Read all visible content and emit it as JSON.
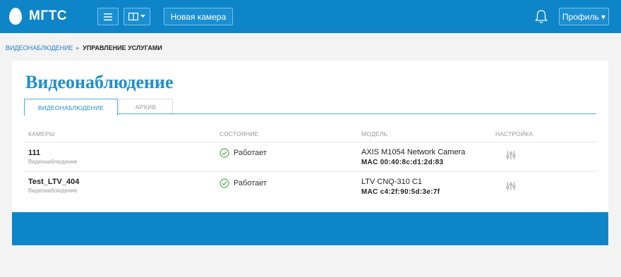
{
  "header": {
    "logo_text": "МГТС",
    "new_camera_label": "Новая камера",
    "profile_label": "Профиль ▾"
  },
  "breadcrumb": {
    "link": "ВИДЕОНАБЛЮДЕНИЕ",
    "separator": "▸",
    "current": "УПРАВЛЕНИЕ УСЛУГАМИ"
  },
  "page": {
    "title": "Видеонаблюдение"
  },
  "tabs": [
    {
      "label": "ВИДЕОНАБЛЮДЕНИЕ",
      "active": true
    },
    {
      "label": "АРХИВ",
      "active": false
    }
  ],
  "table": {
    "headers": [
      "КАМЕРЫ",
      "СОСТОЯНИЕ",
      "МОДЕЛЬ",
      "НАСТРОЙКА"
    ],
    "rows": [
      {
        "name": "111",
        "service": "Видеонаблюдение",
        "status": "Работает",
        "model": "AXIS M1054 Network Camera",
        "mac": "MAC 00:40:8c:d1:2d:83"
      },
      {
        "name": "Test_LTV_404",
        "service": "Видеонаблюдение",
        "status": "Работает",
        "model": "LTV CNQ-310 C1",
        "mac": "MAC c4:2f:90:5d:3e:7f"
      }
    ]
  },
  "colors": {
    "brand_blue": "#0e85c9",
    "title_blue": "#1f8fcf",
    "status_green": "#4caf50"
  },
  "icons": [
    "menu-icon",
    "layout-icon",
    "chevron-down-icon",
    "bell-icon",
    "check-circle-icon",
    "sliders-icon"
  ]
}
